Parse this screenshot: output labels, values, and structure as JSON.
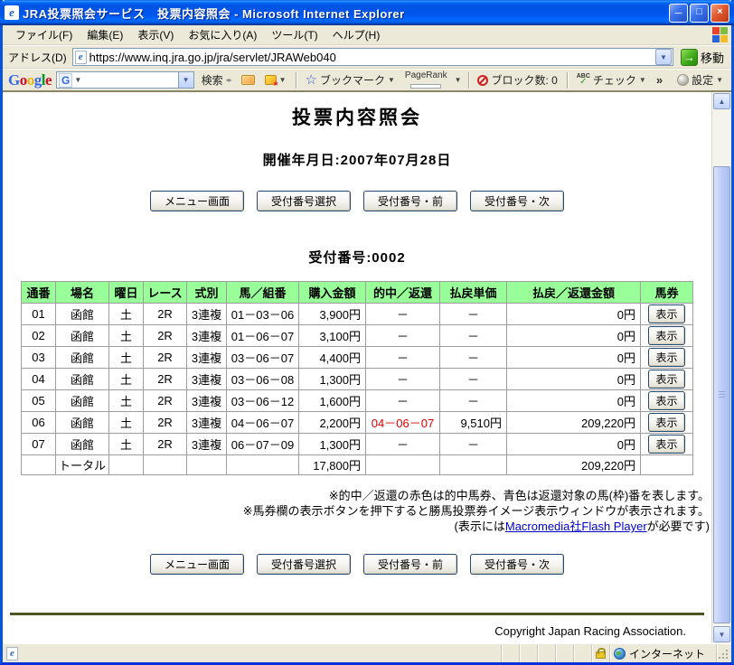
{
  "icons": {
    "minimize": "─",
    "maximize": "□",
    "close": "×",
    "chevron_down": "▼",
    "go_arrow": "→",
    "more": "»",
    "scroll_up": "▲",
    "scroll_down": "▼",
    "tiny_arrows": "◂▸",
    "ie_letter": "e",
    "star": "☆",
    "abc": "ABC",
    "tick": "✓"
  },
  "window": {
    "title": "JRA投票照会サービス　投票内容照会 - Microsoft Internet Explorer"
  },
  "menu": {
    "items": [
      "ファイル(F)",
      "編集(E)",
      "表示(V)",
      "お気に入り(A)",
      "ツール(T)",
      "ヘルプ(H)"
    ]
  },
  "address": {
    "label": "アドレス(D)",
    "url": "https://www.inq.jra.go.jp/jra/servlet/JRAWeb040",
    "go": "移動"
  },
  "gtoolbar": {
    "logo_letters": [
      "G",
      "o",
      "o",
      "g",
      "l",
      "e"
    ],
    "search": "検索",
    "bookmarks": "ブックマーク",
    "pagerank": "PageRank",
    "blocked": "ブロック数: 0",
    "check": "チェック",
    "settings": "設定"
  },
  "page": {
    "title": "投票内容照会",
    "date": "開催年月日:2007年07月28日",
    "receipt": "受付番号:0002",
    "nav_buttons": [
      "メニュー画面",
      "受付番号選択",
      "受付番号・前",
      "受付番号・次"
    ],
    "note1": "※的中／返還の赤色は的中馬券、青色は返還対象の馬(枠)番を表します。",
    "note2": "※馬券欄の表示ボタンを押下すると勝馬投票券イメージ表示ウィンドウが表示されます。",
    "note3_prefix": "(表示には",
    "note3_link": "Macromedia社Flash Player",
    "note3_suffix": "が必要です)",
    "copyright": "Copyright Japan Racing Association."
  },
  "table": {
    "headers": [
      "通番",
      "場名",
      "曜日",
      "レース",
      "式別",
      "馬／組番",
      "購入金額",
      "的中／返還",
      "払戻単価",
      "払戻／返還金額",
      "馬券"
    ],
    "show_button": "表示",
    "header_bg": "#99ff99",
    "hit_color": "#dd0000",
    "rows": [
      {
        "no": "01",
        "place": "函館",
        "day": "土",
        "race": "2R",
        "type": "3連複",
        "combo": "01－03－06",
        "amount": "3,900円",
        "hit": "－",
        "unit": "－",
        "payout": "0円"
      },
      {
        "no": "02",
        "place": "函館",
        "day": "土",
        "race": "2R",
        "type": "3連複",
        "combo": "01－06－07",
        "amount": "3,100円",
        "hit": "－",
        "unit": "－",
        "payout": "0円"
      },
      {
        "no": "03",
        "place": "函館",
        "day": "土",
        "race": "2R",
        "type": "3連複",
        "combo": "03－06－07",
        "amount": "4,400円",
        "hit": "－",
        "unit": "－",
        "payout": "0円"
      },
      {
        "no": "04",
        "place": "函館",
        "day": "土",
        "race": "2R",
        "type": "3連複",
        "combo": "03－06－08",
        "amount": "1,300円",
        "hit": "－",
        "unit": "－",
        "payout": "0円"
      },
      {
        "no": "05",
        "place": "函館",
        "day": "土",
        "race": "2R",
        "type": "3連複",
        "combo": "03－06－12",
        "amount": "1,600円",
        "hit": "－",
        "unit": "－",
        "payout": "0円"
      },
      {
        "no": "06",
        "place": "函館",
        "day": "土",
        "race": "2R",
        "type": "3連複",
        "combo": "04－06－07",
        "amount": "2,200円",
        "hit": "04－06－07",
        "unit": "9,510円",
        "payout": "209,220円"
      },
      {
        "no": "07",
        "place": "函館",
        "day": "土",
        "race": "2R",
        "type": "3連複",
        "combo": "06－07－09",
        "amount": "1,300円",
        "hit": "－",
        "unit": "－",
        "payout": "0円"
      }
    ],
    "total": {
      "label": "トータル",
      "amount": "17,800円",
      "payout": "209,220円"
    }
  },
  "status": {
    "zone": "インターネット"
  }
}
